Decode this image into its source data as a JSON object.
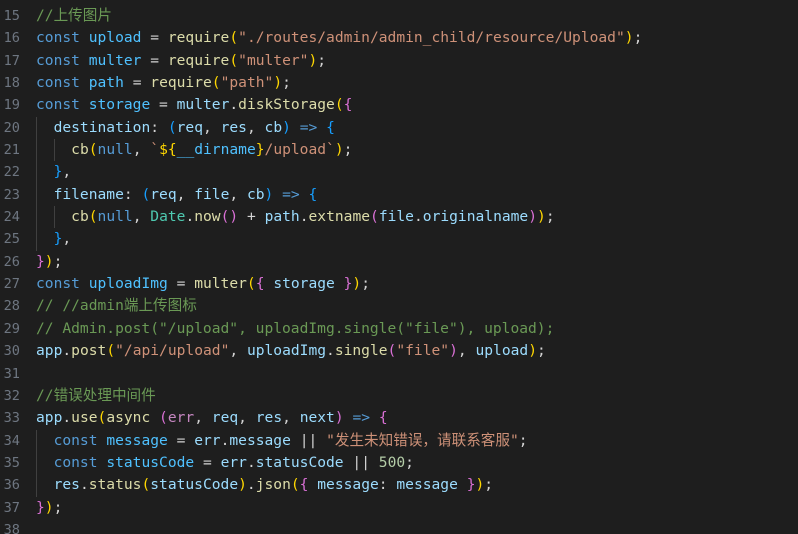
{
  "editor": {
    "theme": "Dark+ (default dark)",
    "language": "JavaScript",
    "background_color": "#1e1e1e",
    "gutter_color": "#6e7681",
    "first_visible_line": 15,
    "line_height_px": 22.35,
    "colors": {
      "comment": "#6a9955",
      "keyword": "#569cd6",
      "variable": "#4fc1ff",
      "function": "#dcdcaa",
      "string": "#ce9178",
      "property": "#9cdcfe",
      "number": "#b5cea8",
      "class": "#4ec9b0",
      "parameter": "#c586c0",
      "bracket_level1": "#ffd700",
      "bracket_level2": "#da70d6",
      "bracket_level3": "#179fff",
      "default_text": "#d4d4d4",
      "indent_guide": "#404040"
    }
  },
  "gutter": {
    "line_numbers": [
      "15",
      "16",
      "17",
      "18",
      "19",
      "20",
      "21",
      "22",
      "23",
      "24",
      "25",
      "26",
      "27",
      "28",
      "29",
      "30",
      "31",
      "32",
      "33",
      "34",
      "35",
      "36",
      "37",
      "38"
    ]
  },
  "code": {
    "lines": [
      {
        "n": "15",
        "text": "//上传图片"
      },
      {
        "n": "16",
        "text": "const upload = require(\"./routes/admin/admin_child/resource/Upload\");"
      },
      {
        "n": "17",
        "text": "const multer = require(\"multer\");"
      },
      {
        "n": "18",
        "text": "const path = require(\"path\");"
      },
      {
        "n": "19",
        "text": "const storage = multer.diskStorage({"
      },
      {
        "n": "20",
        "text": "  destination: (req, res, cb) => {"
      },
      {
        "n": "21",
        "text": "    cb(null, `${__dirname}/upload`);"
      },
      {
        "n": "22",
        "text": "  },"
      },
      {
        "n": "23",
        "text": "  filename: (req, file, cb) => {"
      },
      {
        "n": "24",
        "text": "    cb(null, Date.now() + path.extname(file.originalname));"
      },
      {
        "n": "25",
        "text": "  },"
      },
      {
        "n": "26",
        "text": "});"
      },
      {
        "n": "27",
        "text": "const uploadImg = multer({ storage });"
      },
      {
        "n": "28",
        "text": "// //admin端上传图标"
      },
      {
        "n": "29",
        "text": "// Admin.post(\"/upload\", uploadImg.single(\"file\"), upload);"
      },
      {
        "n": "30",
        "text": "app.post(\"/api/upload\", uploadImg.single(\"file\"), upload);"
      },
      {
        "n": "31",
        "text": ""
      },
      {
        "n": "32",
        "text": "//错误处理中间件"
      },
      {
        "n": "33",
        "text": "app.use(async (err, req, res, next) => {"
      },
      {
        "n": "34",
        "text": "  const message = err.message || \"发生未知错误，请联系客服\";"
      },
      {
        "n": "35",
        "text": "  const statusCode = err.statusCode || 500;"
      },
      {
        "n": "36",
        "text": "  res.status(statusCode).json({ message: message });"
      },
      {
        "n": "37",
        "text": "});"
      },
      {
        "n": "38",
        "text": ""
      }
    ],
    "strings": {
      "upload_module_path": "./routes/admin/admin_child/resource/Upload",
      "multer_module": "multer",
      "path_module": "path",
      "upload_dir_template": "${__dirname}/upload",
      "admin_route": "/upload",
      "api_route": "/api/upload",
      "file_field": "file",
      "default_error_message": "发生未知错误，请联系客服"
    },
    "comments": {
      "upload_image": "//上传图片",
      "admin_upload_icon": "// //admin端上传图标",
      "admin_post_commented": "// Admin.post(\"/upload\", uploadImg.single(\"file\"), upload);",
      "error_middleware": "//错误处理中间件"
    },
    "numbers": {
      "default_status_code": "500"
    },
    "identifiers": [
      "upload",
      "multer",
      "path",
      "storage",
      "destination",
      "req",
      "res",
      "cb",
      "null",
      "__dirname",
      "filename",
      "file",
      "Date",
      "now",
      "extname",
      "originalname",
      "uploadImg",
      "app",
      "post",
      "single",
      "use",
      "async",
      "err",
      "next",
      "message",
      "statusCode",
      "json",
      "status",
      "diskStorage",
      "require",
      "const"
    ]
  }
}
